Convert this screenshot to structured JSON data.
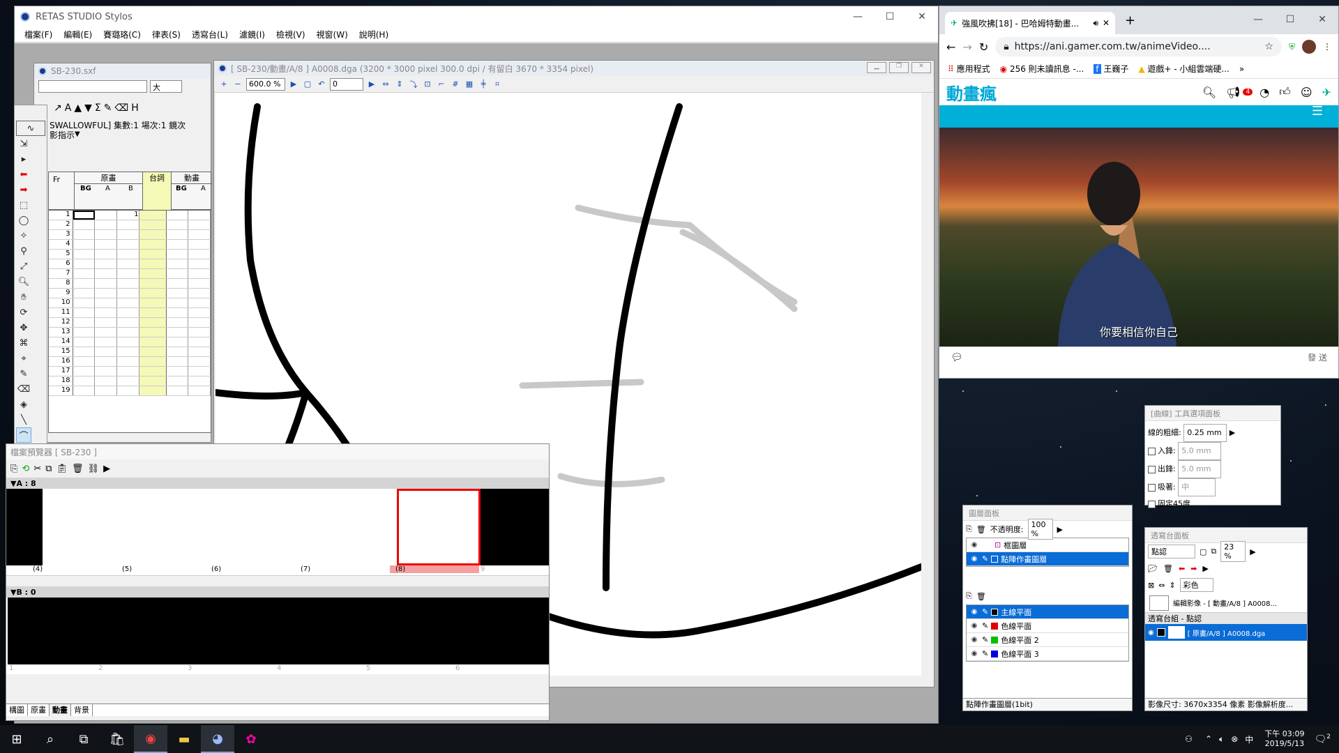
{
  "retas": {
    "title": "RETAS STUDIO Stylos",
    "menu": [
      "檔案(F)",
      "編輯(E)",
      "賽璐珞(C)",
      "律表(S)",
      "透寫台(L)",
      "濾鏡(I)",
      "檢視(V)",
      "視窗(W)",
      "說明(H)"
    ],
    "xsheet_title": "SB-230.sxf",
    "xsheet_info": "SWALLOWFUL] 集數:1  場次:1  鏡次",
    "xsheet_info2": "影指示",
    "xsheet_font_size": "大",
    "col_fr": "Fr",
    "col_genga": "原畫",
    "col_dialogue": "台詞",
    "col_douga": "動畫",
    "sub_bg": "BG",
    "sub_a": "A",
    "sub_b": "B",
    "cell_b1": "1",
    "frames": [
      "1",
      "2",
      "3",
      "4",
      "5",
      "6",
      "7",
      "8",
      "9",
      "10",
      "11",
      "12",
      "13",
      "14",
      "15",
      "16",
      "17",
      "18",
      "19"
    ],
    "canvas_title": "[ SB-230/動畫/A/8 ] A0008.dga (3200 * 3000 pixel 300.0 dpi / 有留白 3670 * 3354 pixel)",
    "zoom": "600.0 %",
    "rotate": "0",
    "swatch_colors": [
      "#0000ff",
      "#000000",
      "#ff0000",
      "#00e000"
    ]
  },
  "browser": {
    "title": "檔案預覽器 [ SB-230 ]",
    "strip_a": "A : 8",
    "strip_b": "B : 0",
    "thumbs_a": [
      "(4)",
      "(5)",
      "(6)",
      "(7)",
      "(8)",
      "9"
    ],
    "thumbs_b": [
      "1",
      "2",
      "3",
      "4",
      "5",
      "6"
    ],
    "tabs": [
      "構圖",
      "原畫",
      "動畫",
      "背景"
    ],
    "active_tab": "動畫"
  },
  "chrome": {
    "tab_title": "強風吹拂[18] - 巴哈姆特動畫...",
    "url": "https://ani.gamer.com.tw/animeVideo....",
    "bookmarks": [
      "應用程式",
      "256 則未讀訊息 -...",
      "王巍子",
      "遊戲+ - 小組雲端硬..."
    ],
    "logo": "動畫瘋",
    "notif_count": "4",
    "subtitle": "你要相信你自己",
    "send": "發 送"
  },
  "tool_options": {
    "title": "[曲線] 工具選項面板",
    "line_width_label": "線的粗細:",
    "line_width": "0.25 mm",
    "in_label": "入鋒:",
    "in_value": "5.0 mm",
    "out_label": "出鋒:",
    "out_value": "5.0 mm",
    "snap_label": "吸著:",
    "snap_value": "中",
    "fixed45": "固定45度"
  },
  "layers": {
    "title": "圖層面板",
    "opacity_label": "不透明度:",
    "opacity": "100 %",
    "upper": [
      "框圖層",
      "點陣作畫圖層"
    ],
    "planes": [
      "主線平面",
      "色線平面",
      "色線平面 2",
      "色線平面 3"
    ],
    "plane_colors": [
      "#000000",
      "#e00000",
      "#00c000",
      "#0000e0"
    ],
    "status": "點陣作畫圖層(1bit)"
  },
  "lighttable": {
    "title": "透寫台面板",
    "mode": "點認",
    "zoom": "23 %",
    "color": "彩色",
    "edit_image": "編輯影像 - [ 動畫/A/8 ] A0008...",
    "group": "透寫台組 - 點認",
    "item": "[ 原畫/A/8 ] A0008.dga",
    "status": "影像尺寸: 3670x3354 像素   影像解析度..."
  },
  "taskbar": {
    "time": "下午 03:09",
    "date": "2019/5/13",
    "notif": "2"
  }
}
